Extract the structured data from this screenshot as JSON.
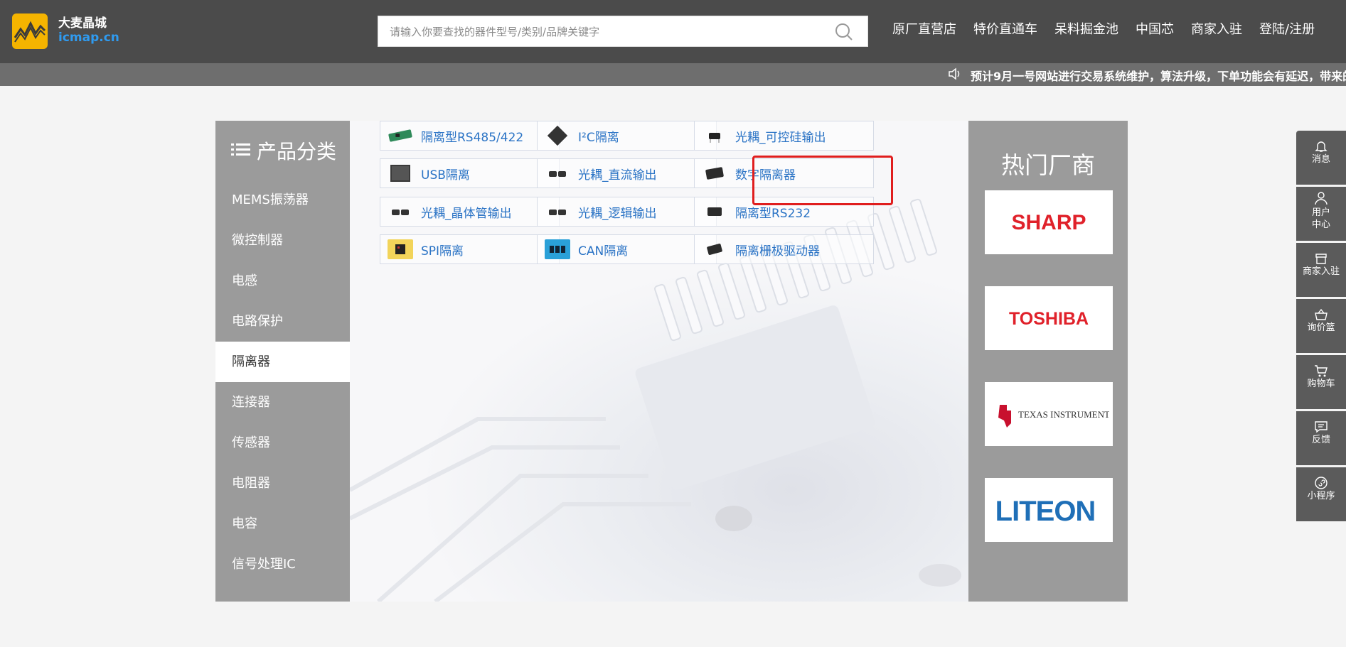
{
  "header": {
    "logo_cn": "大麦晶城",
    "logo_en": "icmap.cn",
    "search_placeholder": "请输入你要查找的器件型号/类别/品牌关键字",
    "nav": [
      "原厂直营店",
      "特价直通车",
      "呆料掘金池",
      "中国芯",
      "商家入驻",
      "登陆/注册"
    ]
  },
  "notice": "预计9月一号网站进行交易系统维护，算法升级，下单功能会有延迟，带来的",
  "category": {
    "title": "产品分类",
    "items": [
      {
        "label": "MEMS振荡器",
        "active": false
      },
      {
        "label": "微控制器",
        "active": false
      },
      {
        "label": "电感",
        "active": false
      },
      {
        "label": "电路保护",
        "active": false
      },
      {
        "label": "隔离器",
        "active": true
      },
      {
        "label": "连接器",
        "active": false
      },
      {
        "label": "传感器",
        "active": false
      },
      {
        "label": "电阻器",
        "active": false
      },
      {
        "label": "电容",
        "active": false
      },
      {
        "label": "信号处理IC",
        "active": false
      }
    ]
  },
  "subcategories": [
    {
      "label": "隔离型RS485/422",
      "icon": "green-board-icon"
    },
    {
      "label": "I²C隔离",
      "icon": "chip-icon"
    },
    {
      "label": "光耦_可控硅输出",
      "icon": "optocoupler-icon"
    },
    {
      "label": "USB隔离",
      "icon": "module-icon"
    },
    {
      "label": "光耦_直流输出",
      "icon": "optocoupler-icon"
    },
    {
      "label": "数字隔离器",
      "icon": "soic-chip-icon"
    },
    {
      "label": "光耦_晶体管输出",
      "icon": "optocoupler-icon"
    },
    {
      "label": "光耦_逻辑输出",
      "icon": "optocoupler-icon"
    },
    {
      "label": "隔离型RS232",
      "icon": "chip-icon"
    },
    {
      "label": "SPI隔离",
      "icon": "spi-chip-icon"
    },
    {
      "label": "CAN隔离",
      "icon": "can-chip-icon"
    },
    {
      "label": "隔离栅极驱动器",
      "icon": "soic-chip-icon"
    }
  ],
  "brands": {
    "title": "热门厂商",
    "items": [
      "SHARP",
      "TOSHIBA",
      "TEXAS INSTRUMENTS",
      "LITEON"
    ]
  },
  "float_toolbar": [
    "消息",
    "用户中心",
    "商家入驻",
    "询价篮",
    "购物车",
    "反馈",
    "小程序"
  ],
  "colors": {
    "header_bg": "#4b4b4b",
    "sidebar_bg": "#9b9b9b",
    "link_blue": "#2a73c5",
    "highlight_red": "#e01e1e",
    "logo_yellow": "#f5b400"
  }
}
